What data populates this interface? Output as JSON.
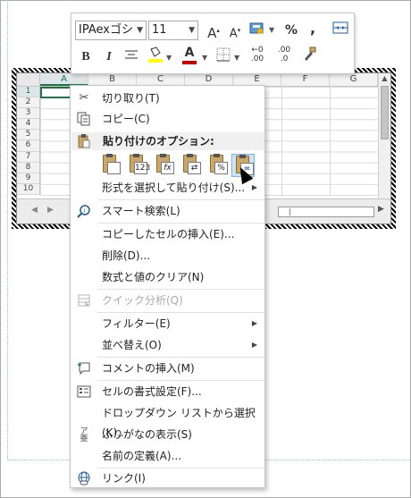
{
  "sheet": {
    "columns": [
      "A",
      "B",
      "C",
      "D",
      "E",
      "F",
      "G"
    ],
    "rows": [
      "1",
      "2",
      "3",
      "4",
      "5",
      "6",
      "7",
      "8",
      "9",
      "10"
    ]
  },
  "mini_toolbar": {
    "font_name": "IPAexゴシ",
    "font_size": "11",
    "percent_label": "%",
    "comma_label": ",",
    "bold_label": "B",
    "italic_label": "I",
    "increase_decimal_label": ".00",
    "decrease_decimal_label": ".0",
    "fill_color": "#ffff00",
    "font_color": "#c00000"
  },
  "context_menu": {
    "cut": "切り取り(T)",
    "copy": "コピー(C)",
    "paste_options": "貼り付けのオプション:",
    "paste_special": "形式を選択して貼り付け(S)...",
    "smart_lookup": "スマート検索(L)",
    "insert_copied_cells": "コピーしたセルの挿入(E)...",
    "delete": "削除(D)...",
    "clear_contents": "数式と値のクリア(N)",
    "quick_analysis": "クイック分析(Q)",
    "filter": "フィルター(E)",
    "sort": "並べ替え(O)",
    "insert_comment": "コメントの挿入(M)",
    "format_cells": "セルの書式設定(F)...",
    "pick_from_dropdown": "ドロップダウン リストから選択(K)...",
    "show_phonetic": "ふりがなの表示(S)",
    "define_name": "名前の定義(A)...",
    "link": "リンク(I)"
  },
  "paste_icons": [
    {
      "name": "paste",
      "overlay": ""
    },
    {
      "name": "paste-values",
      "overlay": "123"
    },
    {
      "name": "paste-formulas",
      "overlay": "fx"
    },
    {
      "name": "paste-transpose",
      "overlay": "⇄"
    },
    {
      "name": "paste-formatting",
      "overlay": "%"
    },
    {
      "name": "paste-link",
      "overlay": "∞"
    }
  ]
}
